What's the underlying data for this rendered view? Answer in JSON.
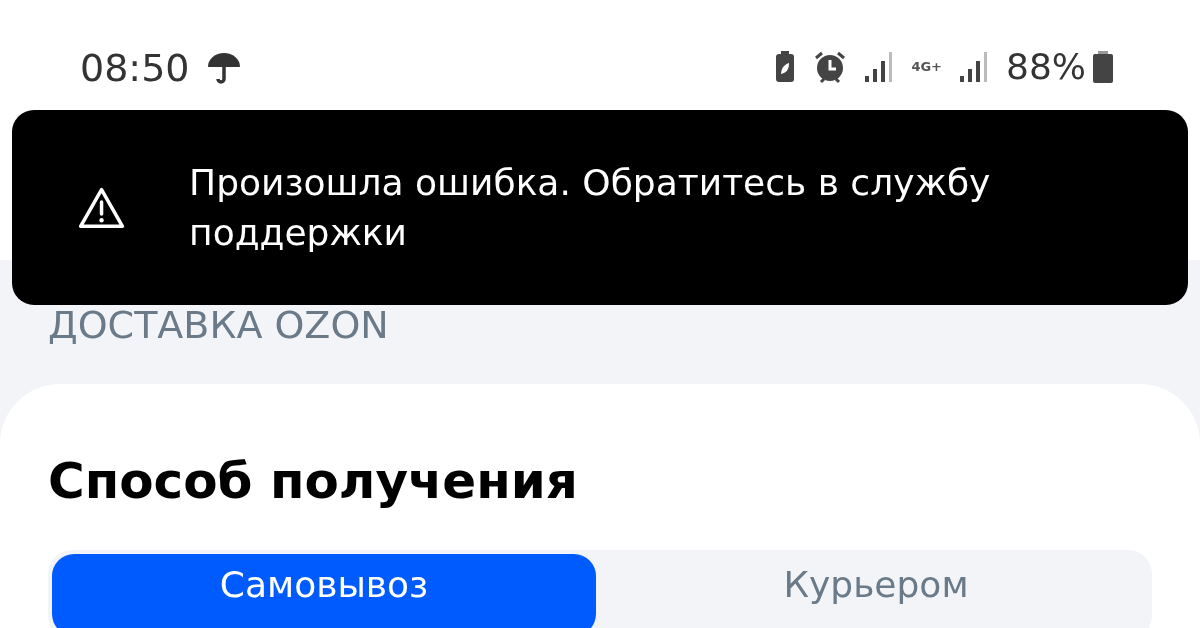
{
  "status_bar": {
    "time": "08:50",
    "network": "4G+",
    "battery": "88%"
  },
  "toast": {
    "message": "Произошла ошибка. Обратитесь в службу поддержки"
  },
  "section_label": "ДОСТАВКА OZON",
  "card": {
    "title": "Способ получения",
    "tabs": [
      {
        "label": "Самовывоз",
        "selected": true
      },
      {
        "label": "Курьером",
        "selected": false
      }
    ]
  }
}
